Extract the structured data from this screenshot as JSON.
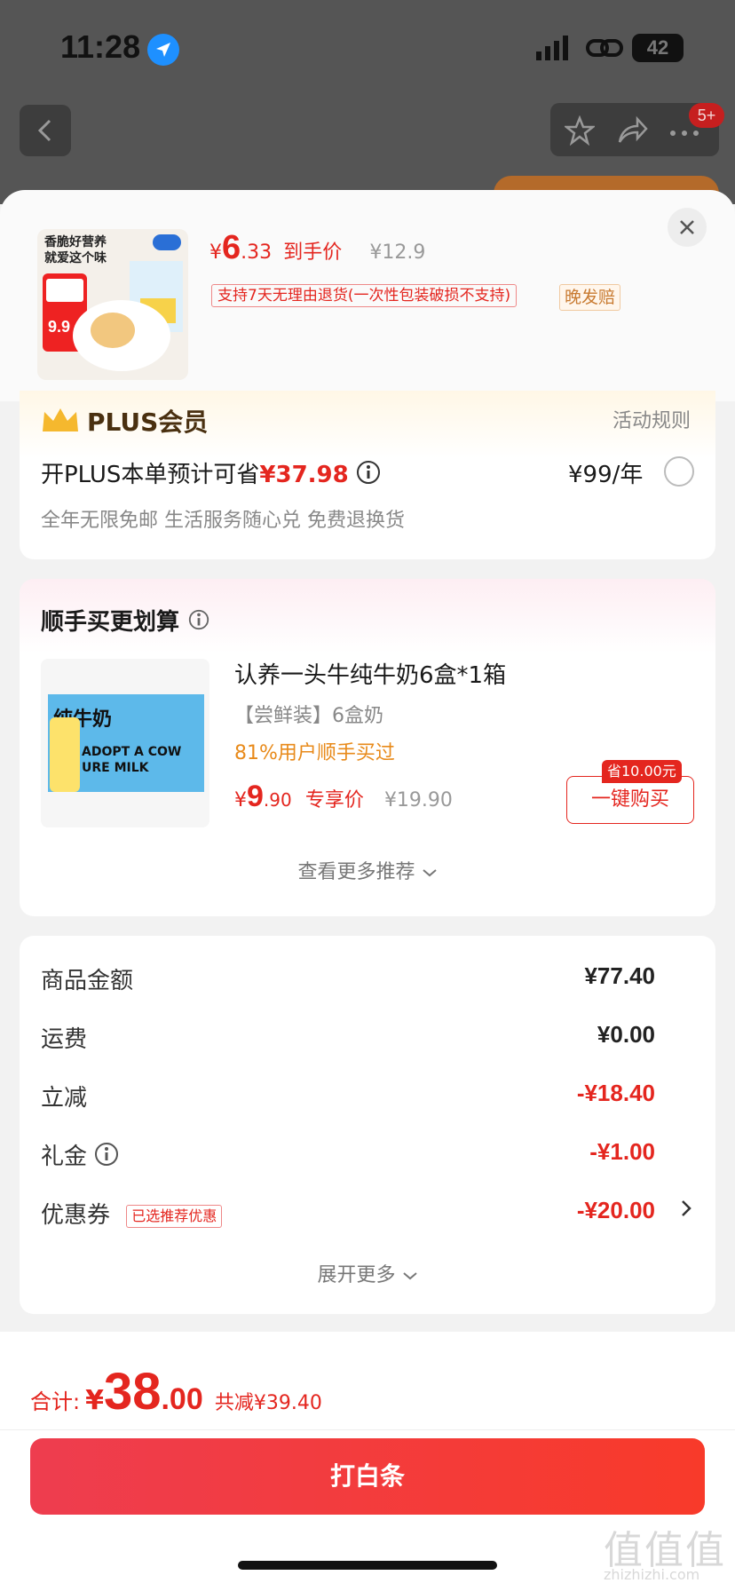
{
  "status_bar": {
    "time": "11:28",
    "battery": "42"
  },
  "nav": {
    "badge": "5+"
  },
  "product": {
    "thumb_text": "香脆好营养\n就爱这个味",
    "thumb_promo_price": "9.9",
    "price_yen": "¥",
    "price_int": "6",
    "price_dec": ".33",
    "price_label": "到手价",
    "orig_price": "¥12.9",
    "return_tag": "支持7天无理由退货(一次性包装破损不支持)",
    "late_tag": "晚发赔"
  },
  "plus": {
    "title": "PLUS会员",
    "rule": "活动规则",
    "save_prefix": "开PLUS本单预计可省",
    "save_amount": "¥37.98",
    "price": "¥99/年",
    "benefits": "全年无限免邮 生活服务随心兑 免费退换货"
  },
  "recommend": {
    "title": "顺手买更划算",
    "item_name": "认养一头牛纯牛奶6盒*1箱",
    "item_spec": "【尝鲜装】6盒奶",
    "item_stat": "81%用户顺手买过",
    "price_yen": "¥",
    "price_int": "9",
    "price_dec": ".90",
    "price_label": "专享价",
    "orig_price": "¥19.90",
    "save_badge": "省10.00元",
    "buy_label": "一键购买",
    "more": "查看更多推荐",
    "img_label": "纯牛奶",
    "img_en": "ADOPT A COW\nURE MILK"
  },
  "summary": {
    "rows": [
      {
        "label": "商品金额",
        "value": "¥77.40"
      },
      {
        "label": "运费",
        "value": "¥0.00"
      },
      {
        "label": "立减",
        "value": "-¥18.40"
      },
      {
        "label": "礼金",
        "value": "-¥1.00"
      },
      {
        "label": "优惠券",
        "value": "-¥20.00",
        "tag": "已选推荐优惠"
      }
    ],
    "expand": "展开更多"
  },
  "footer": {
    "total_label": "合计:",
    "total_yen": "¥",
    "total_int": "38",
    "total_dec": ".00",
    "total_reduce": "共减¥39.40",
    "pay_label": "打白条"
  },
  "watermark": {
    "main": "值值值",
    "sub": "zhizhizhi.com"
  },
  "colors": {
    "accent": "#e4261f",
    "pay_button": "#f0333a"
  }
}
